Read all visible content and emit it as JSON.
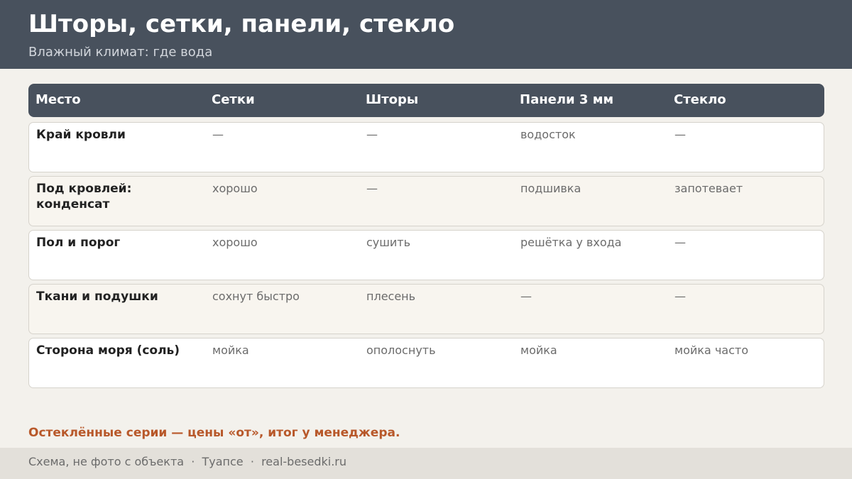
{
  "header": {
    "title": "Шторы, сетки, панели, стекло",
    "subtitle": "Влажный климат: где вода"
  },
  "table": {
    "columns": [
      "Место",
      "Сетки",
      "Шторы",
      "Панели 3 мм",
      "Стекло"
    ],
    "rows": [
      [
        "Край кровли",
        "—",
        "—",
        "водосток",
        "—"
      ],
      [
        "Под кровлей: конденсат",
        "хорошо",
        "—",
        "подшивка",
        "запотевает"
      ],
      [
        "Пол и порог",
        "хорошо",
        "сушить",
        "решётка у входа",
        "—"
      ],
      [
        "Ткани и подушки",
        "сохнут быстро",
        "плесень",
        "—",
        "—"
      ],
      [
        "Сторона моря (соль)",
        "мойка",
        "ополоснуть",
        "мойка",
        "мойка часто"
      ]
    ]
  },
  "note": "Остеклённые серии — цены «от», итог у менеджера.",
  "footer": "Схема, не фото с объекта  ·  Туапсе  ·  real-besedki.ru"
}
